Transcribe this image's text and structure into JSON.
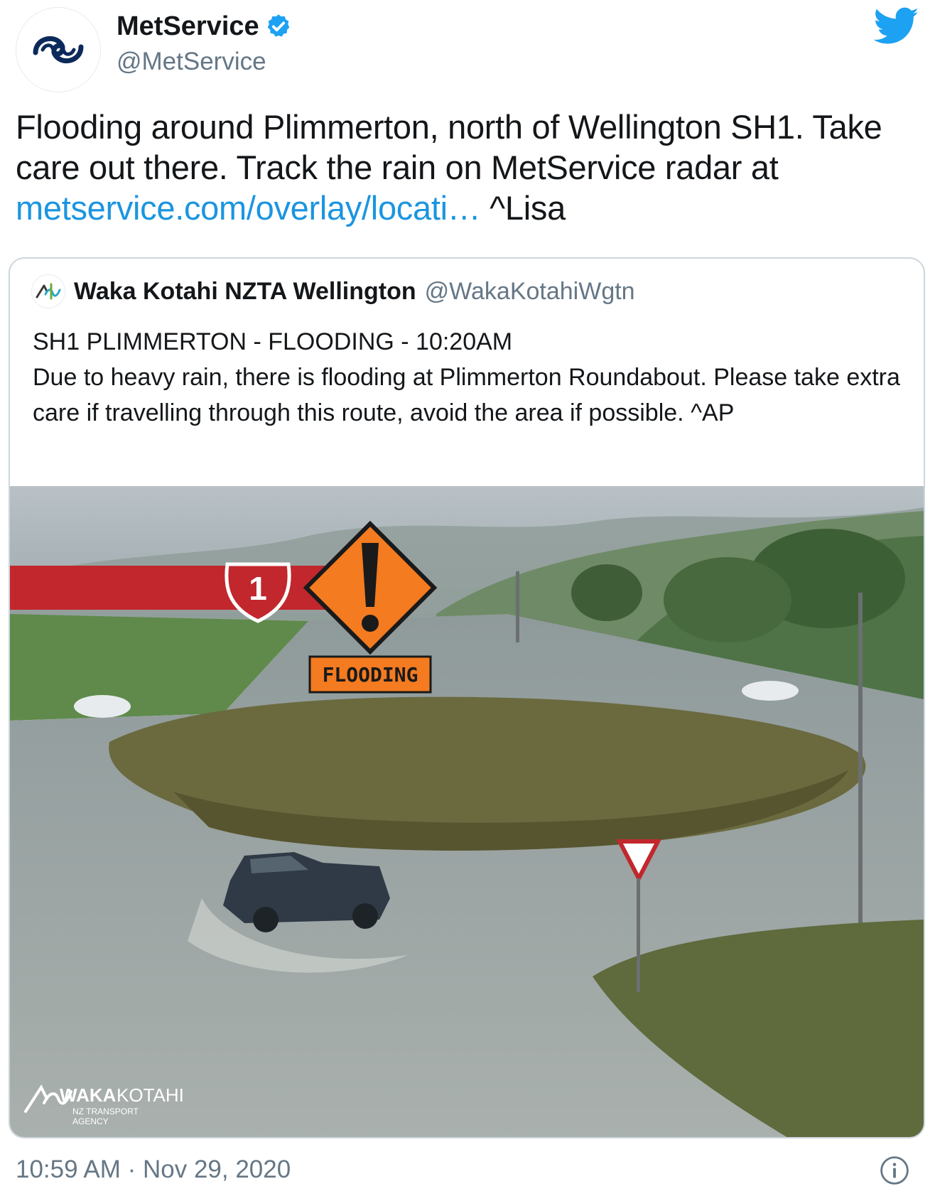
{
  "author": {
    "display_name": "MetService",
    "handle": "@MetService",
    "avatar_icon": "metservice-swirl-logo",
    "verified": true
  },
  "tweet": {
    "text_before_link": "Flooding around Plimmerton, north of Wellington SH1.  Take care out there. Track the rain on MetService radar at ",
    "link_text": "metservice.com/overlay/locati…",
    "text_after_link": " ^Lisa"
  },
  "quoted": {
    "display_name": "Waka Kotahi NZTA Wellington",
    "handle": "@WakaKotahiWgtn",
    "avatar_icon": "waka-kotahi-logo",
    "text": "SH1 PLIMMERTON - FLOODING - 10:20AM\nDue to heavy rain, there is flooding at Plimmerton Roundabout. Please take extra care if travelling through this route, avoid the area if possible. ^AP",
    "media": {
      "highway_number": "1",
      "warning_label": "FLOODING",
      "watermark_brand": "WAKA",
      "watermark_brand_2": "KOTAHI",
      "watermark_sub_1": "NZ TRANSPORT",
      "watermark_sub_2": "AGENCY"
    }
  },
  "footer": {
    "timestamp": "10:59 AM · Nov 29, 2020"
  },
  "colors": {
    "link": "#1b95e0",
    "secondary_text": "#657786",
    "verified_badge": "#1da1f2",
    "twitter_blue": "#1da1f2",
    "warning_orange": "#f47b20",
    "banner_red": "#c1272d"
  },
  "icons": [
    "verified-badge-icon",
    "twitter-bird-icon",
    "info-icon"
  ]
}
